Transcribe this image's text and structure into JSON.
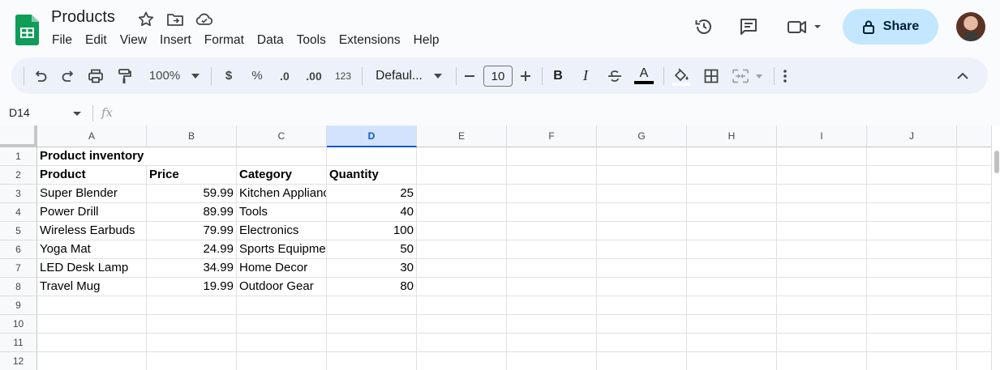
{
  "header": {
    "title": "Products",
    "menu": [
      "File",
      "Edit",
      "View",
      "Insert",
      "Format",
      "Data",
      "Tools",
      "Extensions",
      "Help"
    ],
    "share_label": "Share"
  },
  "toolbar": {
    "zoom": "100%",
    "currency": "$",
    "percent": "%",
    "decrease_decimal": ".0",
    "increase_decimal": ".00",
    "more_formats": "123",
    "font": "Defaul...",
    "font_size": "10",
    "bold": "B",
    "italic": "I",
    "text_color_letter": "A"
  },
  "formula_bar": {
    "name_box": "D14",
    "fx": "fx"
  },
  "colors": {
    "accent": "#0b57d0",
    "share_bg": "#c2e7ff",
    "logo_green": "#0f9d58"
  },
  "sheet": {
    "columns": [
      "A",
      "B",
      "C",
      "D",
      "E",
      "F",
      "G",
      "H",
      "I",
      "J"
    ],
    "selected_column": "D",
    "rows": [
      "1",
      "2",
      "3",
      "4",
      "5",
      "6",
      "7",
      "8",
      "9",
      "10",
      "11",
      "12"
    ],
    "cells": [
      [
        "Product inventory",
        "",
        "",
        ""
      ],
      [
        "Product",
        "Price",
        "Category",
        "Quantity"
      ],
      [
        "Super Blender",
        "59.99",
        "Kitchen Appliances",
        "25"
      ],
      [
        "Power Drill",
        "89.99",
        "Tools",
        "40"
      ],
      [
        "Wireless Earbuds",
        "79.99",
        "Electronics",
        "100"
      ],
      [
        "Yoga Mat",
        "24.99",
        "Sports Equipment",
        "50"
      ],
      [
        "LED Desk Lamp",
        "34.99",
        "Home Decor",
        "30"
      ],
      [
        "Travel Mug",
        "19.99",
        "Outdoor Gear",
        "80"
      ]
    ]
  }
}
